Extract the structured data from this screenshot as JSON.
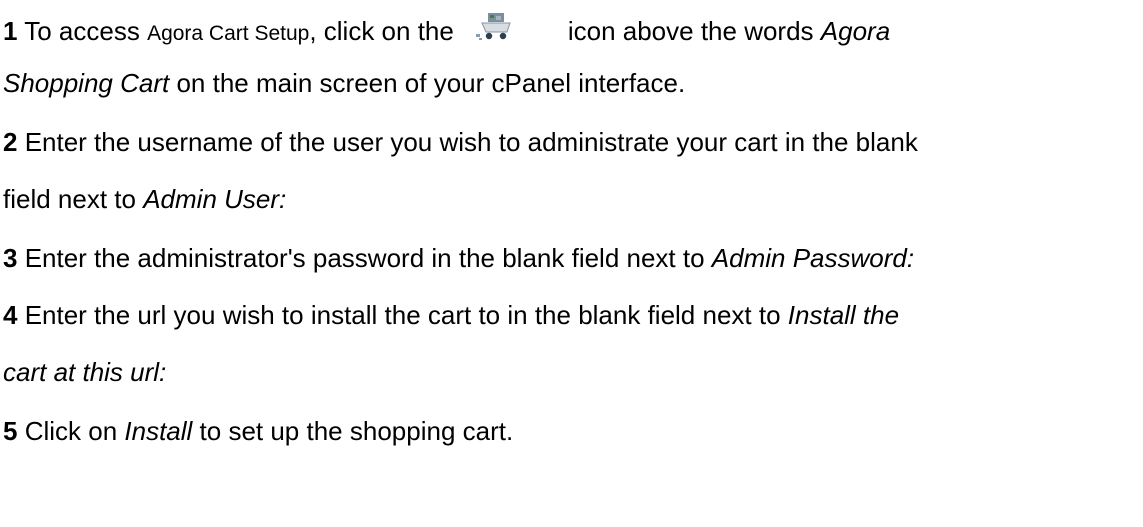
{
  "steps": [
    {
      "number": "1",
      "text_before_app": " To access ",
      "app_name": "Agora Cart Setup",
      "text_before_icon": ", click on the",
      "icon": "shopping-cart-icon",
      "text_after_icon": "icon above the words ",
      "emphasis_1": "Agora",
      "emphasis_2": "Shopping Cart",
      "text_end": " on the main screen of your cPanel interface."
    },
    {
      "number": "2",
      "text": " Enter the username of the user you wish to administrate your cart in the blank",
      "text_2": "field next to ",
      "emphasis": "Admin User:"
    },
    {
      "number": "3",
      "text": " Enter the administrator's password in the blank field next to ",
      "emphasis": "Admin Password:"
    },
    {
      "number": "4",
      "text": " Enter the url you wish to install the cart to in the blank field next to ",
      "emphasis_1": "Install the",
      "emphasis_2": "cart at this url:"
    },
    {
      "number": "5",
      "text_before": " Click on ",
      "emphasis": "Install",
      "text_after": " to set up the shopping cart."
    }
  ]
}
